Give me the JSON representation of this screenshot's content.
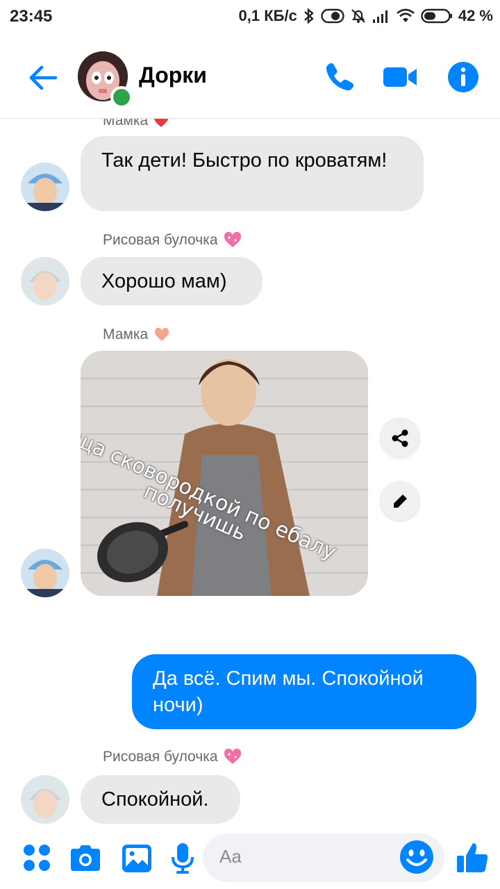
{
  "status_bar": {
    "time": "23:45",
    "net_speed": "0,1 КБ/с",
    "battery": "42 %",
    "icons": [
      "bluetooth-icon",
      "toggle-icon",
      "mute-icon",
      "signal-icon",
      "wifi-icon",
      "battery-icon"
    ]
  },
  "header": {
    "title": "Дорки",
    "icons": [
      "back-arrow-icon",
      "phone-icon",
      "video-icon",
      "info-icon"
    ],
    "online": true
  },
  "messages": [
    {
      "sender": "Мамка",
      "sender_heart": "red-heart-icon",
      "text": "Так дети! Быстро по кроватям!",
      "direction": "in"
    },
    {
      "sender": "Рисовая булочка",
      "sender_heart": "sparkling-heart-icon",
      "text": "Хорошо мам)",
      "direction": "in"
    },
    {
      "sender": "Мамка",
      "sender_heart": "peach-heart-icon",
      "type": "image",
      "caption_line1": "ща сковородкой по ебалу",
      "caption_line2": "получишь",
      "direction": "in"
    },
    {
      "text": "Да всё. Спим мы. Спокойной ночи)",
      "direction": "out"
    },
    {
      "sender": "Рисовая булочка",
      "sender_heart": "sparkling-heart-icon",
      "text": "Спокойной.",
      "direction": "in"
    }
  ],
  "composer": {
    "placeholder": "Aa",
    "icons": [
      "menu-dots-icon",
      "camera-icon",
      "gallery-icon",
      "microphone-icon",
      "emoji-icon",
      "thumbs-up-icon"
    ]
  },
  "colors": {
    "accent": "#0084ff",
    "incoming_bubble": "#e9e9eb",
    "online": "#31a24c"
  }
}
